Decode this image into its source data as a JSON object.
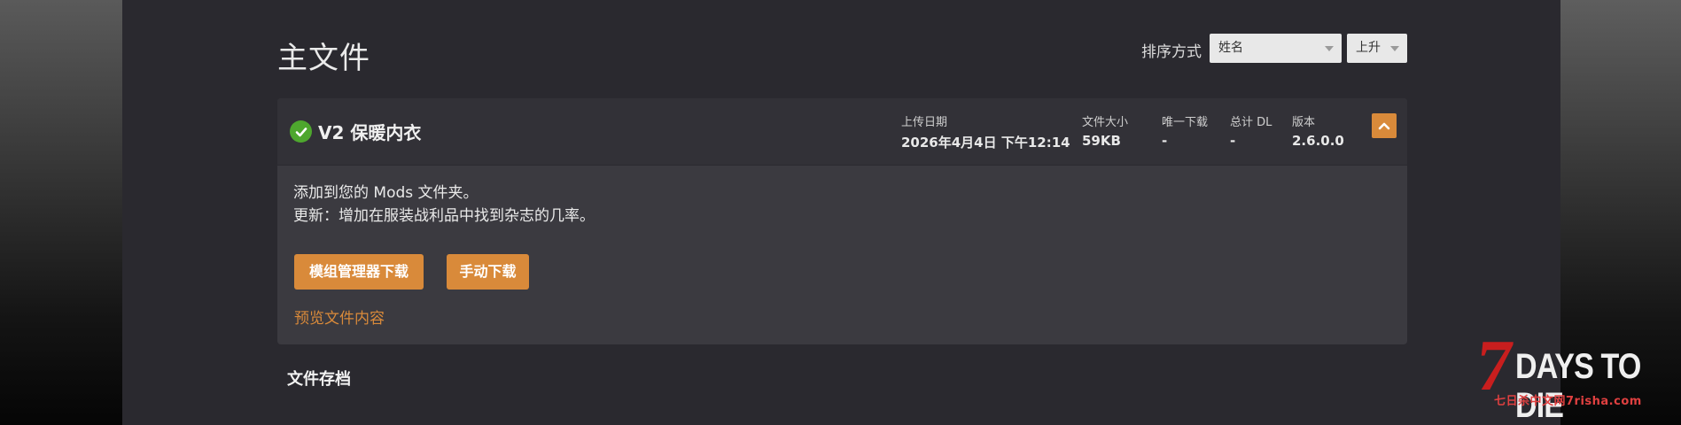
{
  "page_title": "主文件",
  "sort": {
    "label": "排序方式",
    "field_value": "姓名",
    "order_value": "上升"
  },
  "file": {
    "name": "V2 保暖内衣",
    "meta": {
      "upload_date_label": "上传日期",
      "upload_date": "2026年4月4日 下午12:14",
      "size_label": "文件大小",
      "size": "59KB",
      "unique_dl_label": "唯一下载",
      "unique_dl": "-",
      "total_dl_label": "总计 DL",
      "total_dl": "-",
      "version_label": "版本",
      "version": "2.6.0.0"
    },
    "description_line1": "添加到您的 Mods 文件夹。",
    "description_line2": "更新：增加在服装战利品中找到杂志的几率。",
    "mod_manager_button": "模组管理器下载",
    "manual_button": "手动下载",
    "preview_link": "预览文件内容"
  },
  "archive_title": "文件存档",
  "logo": {
    "main": "DAYS TO DIE",
    "sub": "七日杀中文网7risha.com"
  },
  "colors": {
    "accent": "#d98a3a",
    "check": "#4ea72e",
    "logo_red": "#c81e1e"
  },
  "icons": {
    "status": "check-circle-icon",
    "collapse": "chevron-up-icon",
    "dropdown": "caret-down-icon"
  }
}
